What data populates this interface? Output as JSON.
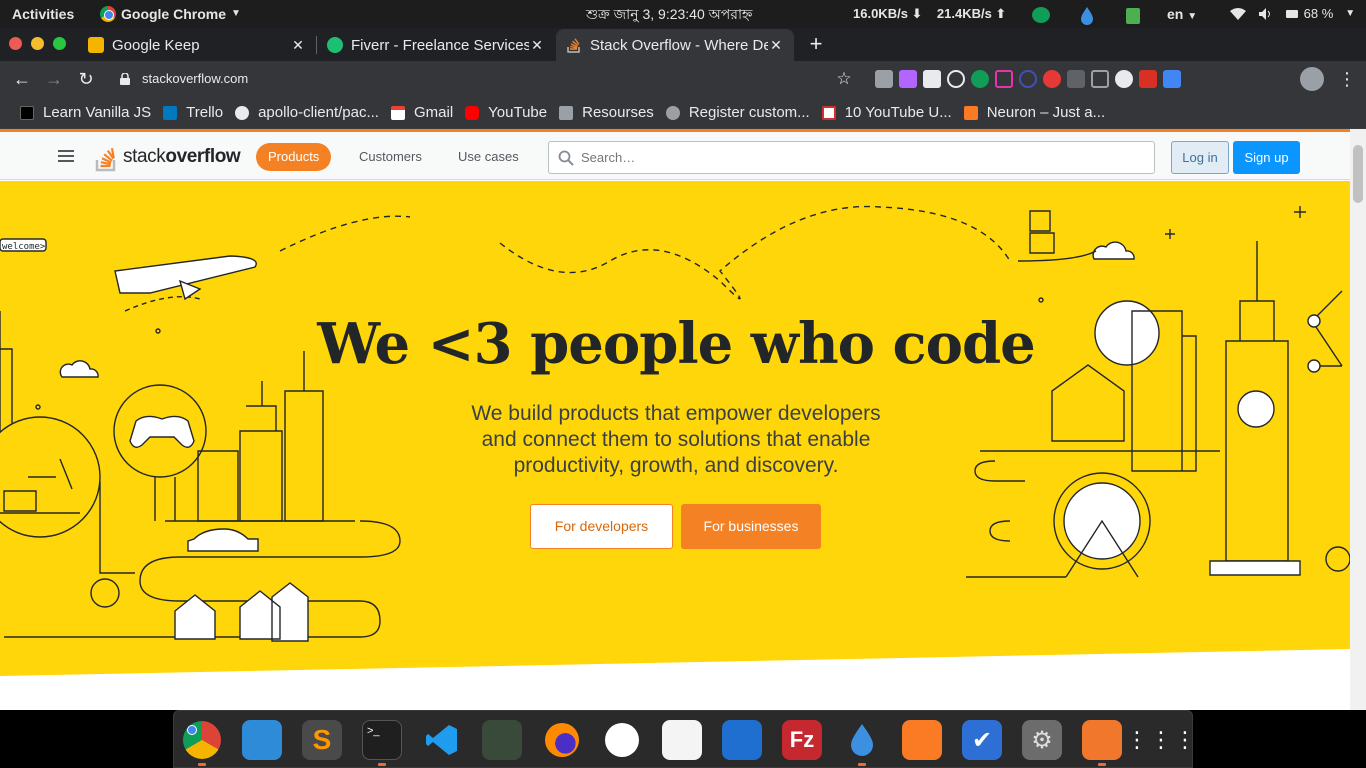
{
  "system_bar": {
    "activities": "Activities",
    "app_name": "Google Chrome",
    "clock": "শুক্র জানু  3,  9:23:40 অপরাহ্ন",
    "net_down": "16.0KB/s ⬇",
    "net_up": "21.4KB/s ⬆",
    "language": "en",
    "battery": "68 %"
  },
  "browser": {
    "tabs": [
      {
        "title": "Google Keep",
        "active": false
      },
      {
        "title": "Fiverr - Freelance Services",
        "active": false
      },
      {
        "title": "Stack Overflow - Where Developers",
        "active": true
      }
    ],
    "new_tab": "+",
    "url": "stackoverflow.com",
    "bookmarks": [
      {
        "label": "Learn Vanilla JS",
        "icon": "folder-icon"
      },
      {
        "label": "Trello",
        "icon": "trello-icon"
      },
      {
        "label": "apollo-client/pac...",
        "icon": "github-icon"
      },
      {
        "label": "Gmail",
        "icon": "gmail-icon"
      },
      {
        "label": "YouTube",
        "icon": "youtube-icon"
      },
      {
        "label": "Resourses",
        "icon": "folder-icon"
      },
      {
        "label": "Register custom...",
        "icon": "globe-icon"
      },
      {
        "label": "10 YouTube U...",
        "icon": "bookmark-icon"
      },
      {
        "label": "Neuron – Just a...",
        "icon": "xampp-icon"
      }
    ]
  },
  "so": {
    "logo_light": "stack",
    "logo_bold": "overflow",
    "nav": [
      "Products",
      "Customers",
      "Use cases"
    ],
    "search_placeholder": "Search…",
    "login": "Log in",
    "signup": "Sign up",
    "hero_title": "We <3 people who code",
    "hero_sub": "We build products that empower developers and connect them to solutions that enable productivity, growth, and discovery.",
    "btn_developers": "For developers",
    "btn_businesses": "For businesses",
    "welcome_tag": "welcome>"
  },
  "colors": {
    "hero_bg": "#ffd60a",
    "accent_orange": "#f48225",
    "signup_blue": "#0a95ff"
  }
}
